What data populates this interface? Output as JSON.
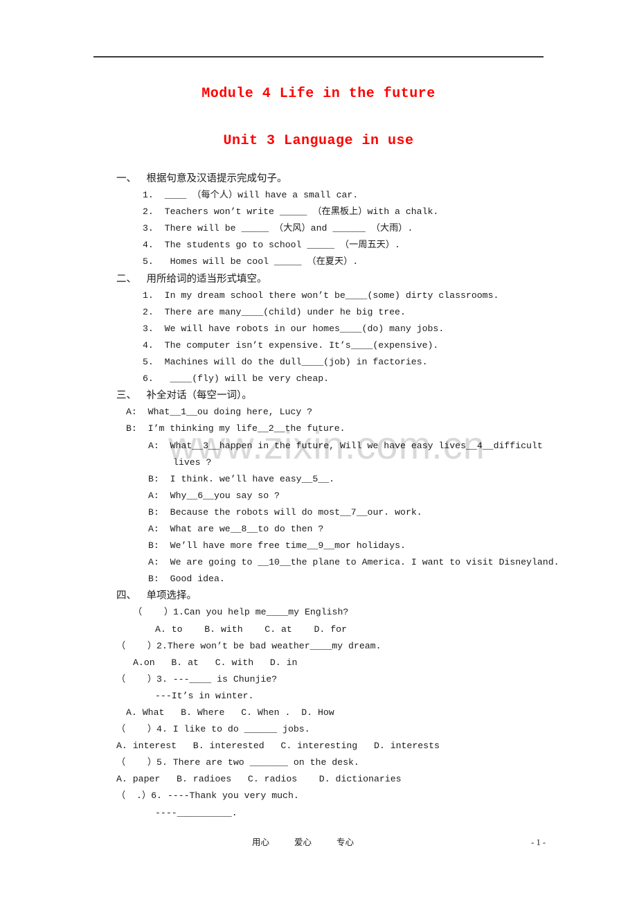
{
  "document": {
    "title_module": "Module 4 Life in the future",
    "title_unit": "Unit 3 Language in use",
    "title_color": "#ff0000",
    "watermark": "www.zixin.com.cn"
  },
  "sections": {
    "one": {
      "heading": "一、    根据句意及汉语提示完成句子。",
      "items": [
        "1.  ____ （每个人）will have a small car.",
        "2.  Teachers won’t write _____ （在黑板上）with a chalk.",
        "3.  There will be _____ （大风）and ______ （大雨）.",
        "4.  The students go to school _____ （一周五天）.",
        "5.   Homes will be cool _____ （在夏天）."
      ]
    },
    "two": {
      "heading": "二、    用所给词的适当形式填空。",
      "items": [
        "1.  In my dream school there won’t be____(some) dirty classrooms.",
        "2.  There are many____(child) under he big tree.",
        "3.  We will have robots in our homes____(do) many jobs.",
        "4.  The computer isn’t expensive. It’s____(expensive).",
        "5.  Machines will do the dull____(job) in factories.",
        "6.   ____(fly) will be very cheap."
      ]
    },
    "three": {
      "heading": "三、    补全对话（每空一词）。",
      "lines": [
        "A:  What__1__ou doing here, Lucy ?",
        "B:  I’m thinking my life__2__the future.",
        "A:  What__3__happen in the future, Will we have easy lives__4__difficult",
        "lives ?",
        "B:  I think. we’ll have easy__5__.",
        "A:  Why__6__you say so ?",
        "B:  Because the robots will do most__7__our. work.",
        "A:  What are we__8__to do then ?",
        "B:  We’ll have more free time__9__mor holidays.",
        "A:  We are going to __10__the plane to America. I want to visit Disneyland.",
        "B:  Good idea."
      ]
    },
    "four": {
      "heading": "四、    单项选择。",
      "lines": [
        "（    ）1.Can you help me____my English?",
        "A. to    B. with    C. at    D. for",
        "（    ）2.There won’t be bad weather____my dream.",
        "A.on   B. at   C. with   D. in",
        "（    ）3. ---____ is Chunjie?",
        "---It’s in winter.",
        "A. What   B. Where   C. When .  D. How",
        "（    ）4. I like to do ______ jobs.",
        "A. interest   B. interested   C. interesting   D. interests",
        "（    ）5. There are two _______ on the desk.",
        "A. paper   B. radioes   C. radios    D. dictionaries",
        "（  .）6. ----Thank you very much.",
        "----__________."
      ]
    }
  },
  "footer": {
    "words": [
      "用心",
      "爱心",
      "专心"
    ],
    "page_label": "- 1 -"
  }
}
